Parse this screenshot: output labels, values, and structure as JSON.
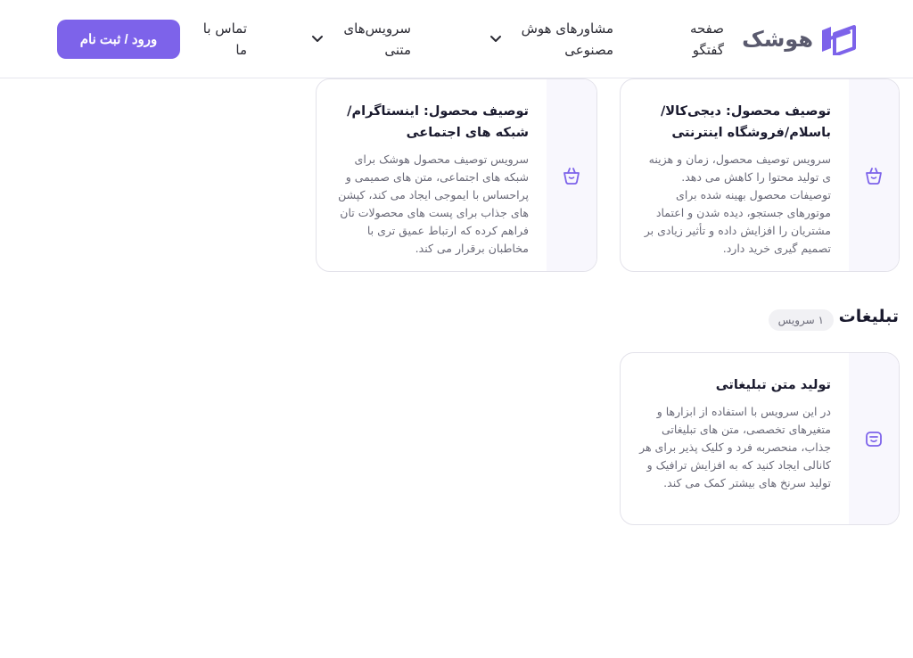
{
  "header": {
    "logo_text": "هوشک",
    "nav": [
      {
        "label": "صفحه\nگفتگو"
      },
      {
        "label": "مشاورهای هوش\nمصنوعی"
      },
      {
        "label": "سرویس‌های\nمتنی"
      },
      {
        "label": "تماس با\nما"
      }
    ],
    "login_label": "ورود / ثبت نام"
  },
  "cards": [
    {
      "title": "توصیف محصول: دیجی‌کالا/\nباسلام/فروشگاه اینترنتی",
      "description": "سرویس توصیف محصول، زمان و هزینه ی تولید محتوا را کاهش می دهد. توصیفات محصول بهینه شده برای موتورهای جستجو، دیده شدن و اعتماد مشتریان را افزایش داده و تأثیر زیادی بر تصمیم گیری خرید دارد.",
      "icon": "basket-icon"
    },
    {
      "title": "توصیف محصول: اینستاگرام/\nشبکه های اجتماعی",
      "description": "سرویس توصیف محصول هوشک برای شبکه های اجتماعی، متن های صمیمی و پراحساس با ایموجی ایجاد می کند، کپشن های جذاب برای پست های محصولات تان فراهم کرده که ارتباط عمیق تری با مخاطبان برقرار می کند.",
      "icon": "basket-icon"
    }
  ],
  "ads_section": {
    "title": "تبلیغات",
    "badge": "۱ سرویس",
    "cards": [
      {
        "title": "تولید متن تبلیغاتی",
        "description": "در این سرویس با استفاده از ابزارها و متغیرهای تخصصی، متن های تبلیغاتی جذاب، منحصربه فرد و کلیک پذیر برای هر کانالی ایجاد کنید که به افزایش ترافیک و تولید سرنخ های بیشتر کمک می کند.",
        "icon": "megaphone-icon"
      }
    ]
  },
  "colors": {
    "accent": "#7d63ea",
    "icon": "#7d63ea",
    "card_icon_bg": "#f8f7fd"
  }
}
